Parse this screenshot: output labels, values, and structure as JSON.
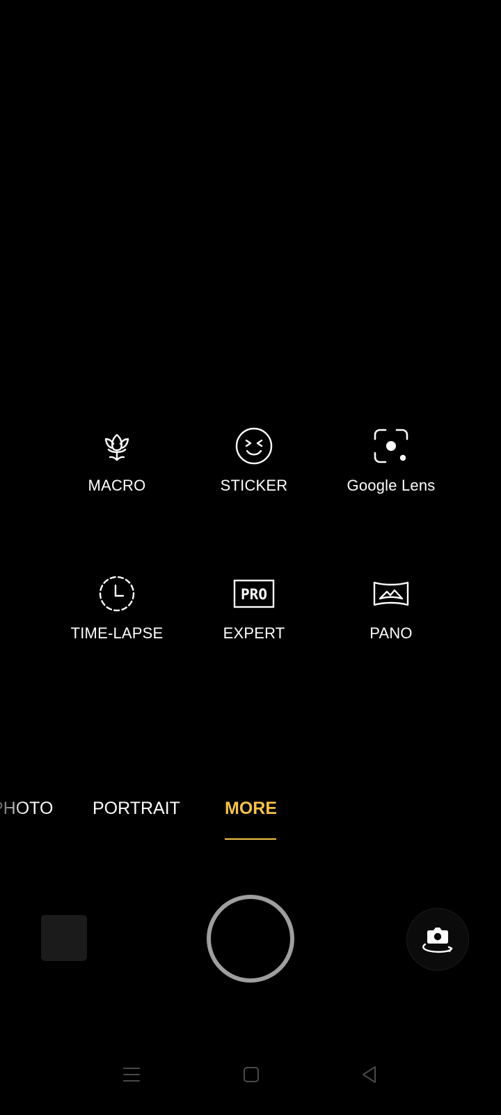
{
  "modes": [
    {
      "label": "MACRO",
      "icon": "macro-flower-icon"
    },
    {
      "label": "STICKER",
      "icon": "sticker-face-icon"
    },
    {
      "label": "Google Lens",
      "icon": "google-lens-icon"
    },
    {
      "label": "TIME-LAPSE",
      "icon": "time-lapse-clock-icon"
    },
    {
      "label": "EXPERT",
      "icon": "pro-badge-icon"
    },
    {
      "label": "PANO",
      "icon": "panorama-icon"
    }
  ],
  "expert_badge_text": "PRO",
  "mode_tabs": [
    {
      "label": "PHOTO",
      "active": false
    },
    {
      "label": "PORTRAIT",
      "active": false
    },
    {
      "label": "MORE",
      "active": true
    }
  ],
  "colors": {
    "accent": "#f5c24a",
    "background": "#000000",
    "shutter_ring": "#9e9e9e",
    "text": "#ffffff"
  },
  "controls": {
    "gallery_icon": "gallery-thumbnail",
    "shutter_icon": "shutter-icon",
    "flip_icon": "flip-camera-icon"
  },
  "nav": {
    "menu_icon": "menu-icon",
    "home_icon": "home-icon",
    "back_icon": "back-icon"
  }
}
